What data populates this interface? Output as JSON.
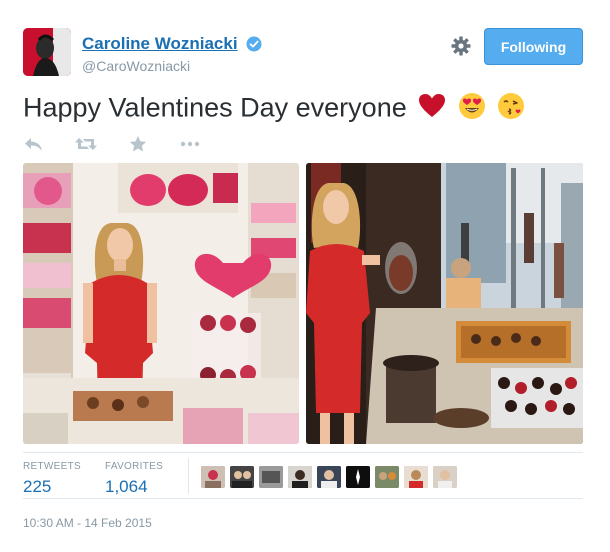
{
  "author": {
    "display_name": "Caroline Wozniacki",
    "handle": "@CaroWozniacki",
    "verified": true
  },
  "follow_button": {
    "label": "Following"
  },
  "tweet": {
    "text": "Happy Valentines Day everyone",
    "emoji": [
      "red-heart",
      "heart-eyes-face",
      "face-blowing-kiss"
    ]
  },
  "actions": [
    "reply-icon",
    "retweet-icon",
    "favorite-icon",
    "more-icon"
  ],
  "stats": {
    "retweets_label": "RETWEETS",
    "retweets_value": "225",
    "favorites_label": "FAVORITES",
    "favorites_value": "1,064"
  },
  "favoriters_count_shown": 9,
  "timestamp": "10:30 AM - 14 Feb 2015",
  "colors": {
    "link_blue": "#1b6fb3",
    "follow_blue": "#55acee",
    "muted_gray": "#8899a6",
    "dress_red": "#d42a2a"
  }
}
